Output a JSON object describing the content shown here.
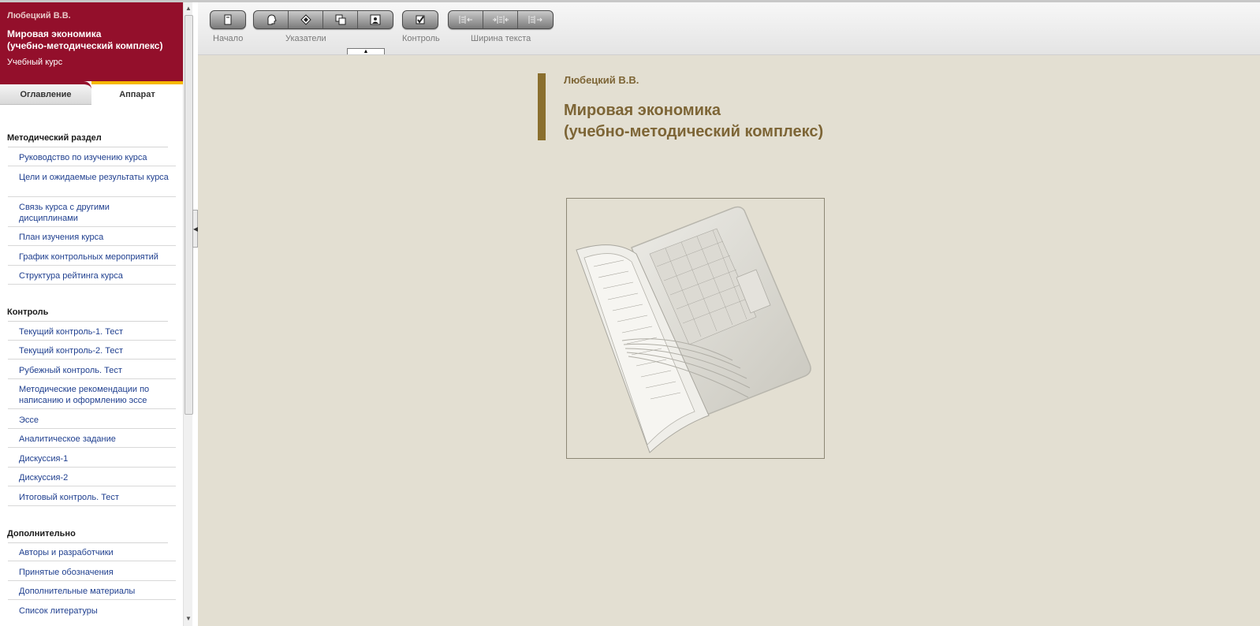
{
  "header": {
    "author": "Любецкий В.В.",
    "title_line1": "Мировая экономика",
    "title_line2": "(учебно-методический комплекс)",
    "subtitle": "Учебный курс"
  },
  "tabs": [
    {
      "label": "Оглавление"
    },
    {
      "label": "Аппарат"
    }
  ],
  "sections": [
    {
      "title": "Методический раздел",
      "items": [
        "Руководство по изучению курса",
        "Цели и ожидаемые результаты курса",
        "Связь курса с другими дисциплинами",
        "План изучения курса",
        "График контрольных мероприятий",
        "Структура рейтинга курса"
      ]
    },
    {
      "title": "Контроль",
      "items": [
        "Текущий контроль-1. Тест",
        "Текущий контроль-2. Тест",
        "Рубежный контроль. Тест",
        "Методические рекомендации по написанию и оформлению эссе",
        "Эссе",
        "Аналитическое задание",
        "Дискуссия-1",
        "Дискуссия-2",
        "Итоговый контроль. Тест"
      ]
    },
    {
      "title": "Дополнительно",
      "items": [
        "Авторы и разработчики",
        "Принятые обозначения",
        "Дополнительные материалы",
        "Список литературы"
      ]
    }
  ],
  "toolbar": {
    "home_label": "Начало",
    "pointers_label": "Указатели",
    "control_label": "Контроль",
    "text_width_label": "Ширина текста",
    "icons": [
      "home-icon",
      "head-icon",
      "diamond-icon",
      "windows-icon",
      "portrait-icon",
      "checkbox-icon",
      "narrow-text-icon",
      "medium-text-icon",
      "wide-text-icon"
    ]
  },
  "main": {
    "author": "Любецкий В.В.",
    "title_line1": "Мировая экономика",
    "title_line2": "(учебно-методический комплекс)"
  },
  "colors": {
    "brand": "#930f2b",
    "accent_tab": "#f6b800",
    "content_bg": "#e3dfd2",
    "heading": "#7d6536",
    "link": "#1f3f8f"
  }
}
